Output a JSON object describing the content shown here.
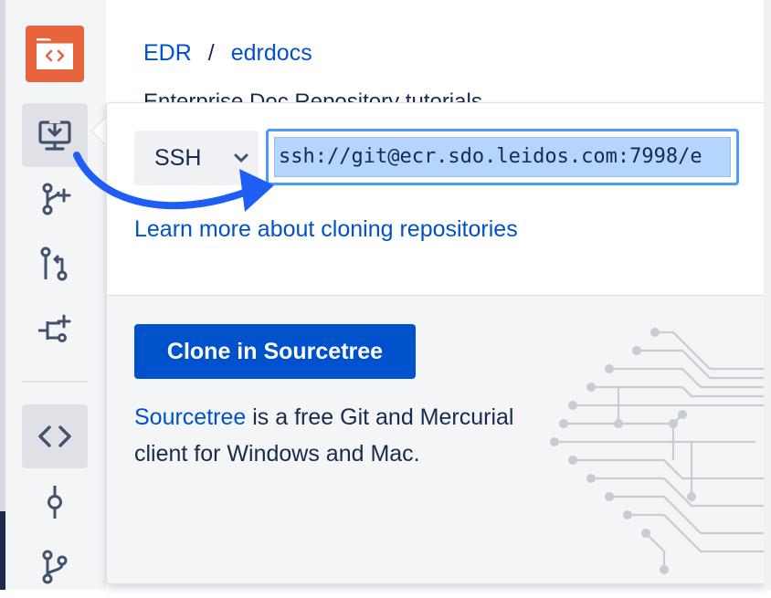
{
  "breadcrumb": {
    "project": "EDR",
    "separator": "/",
    "repo": "edrdocs"
  },
  "page_subtitle": "Enterprise Doc Repository tutorials",
  "sidebar": {
    "items": [
      {
        "name": "clone",
        "icon": "clone-icon",
        "active": true
      },
      {
        "name": "create-branch",
        "icon": "branch-plus-icon"
      },
      {
        "name": "create-pull-request",
        "icon": "pull-request-icon"
      },
      {
        "name": "fork",
        "icon": "fork-icon"
      },
      {
        "name": "source",
        "icon": "code-icon"
      },
      {
        "name": "commits",
        "icon": "commit-icon"
      },
      {
        "name": "branches",
        "icon": "branches-icon"
      }
    ]
  },
  "clone_popup": {
    "protocol": "SSH",
    "url": "ssh://git@ecr.sdo.leidos.com:7998/e",
    "learn_more": "Learn more about cloning repositories",
    "clone_button": "Clone in Sourcetree",
    "desc_link": "Sourcetree",
    "desc_rest": " is a free Git and Mercurial client for Windows and Mac."
  },
  "colors": {
    "accent": "#0052cc",
    "logo": "#e8643c",
    "focus": "#4c9aff",
    "arrow": "#1f5ef5"
  }
}
